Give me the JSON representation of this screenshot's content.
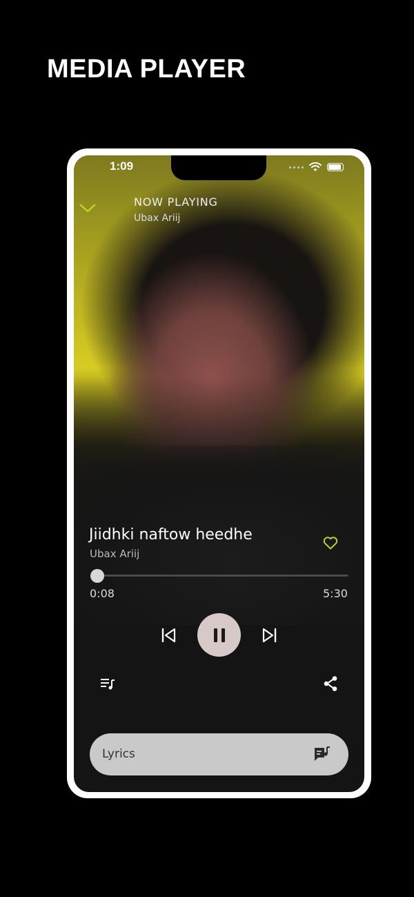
{
  "promo": {
    "title": "MEDIA PLAYER"
  },
  "status_bar": {
    "time": "1:09"
  },
  "header": {
    "now_playing_label": "NOW PLAYING",
    "artist": "Ubax Ariij"
  },
  "track": {
    "title": "Jiidhki naftow heedhe",
    "artist": "Ubax Ariij"
  },
  "progress": {
    "current": "0:08",
    "total": "5:30",
    "fraction": 0.024
  },
  "lyrics": {
    "label": "Lyrics"
  },
  "colors": {
    "accent": "#b5d62b",
    "play_button": "#d6c9c8",
    "lyrics_bar": "#c9c9c9"
  },
  "icons": [
    "chevron-down-icon",
    "heart-icon",
    "skip-previous-icon",
    "pause-icon",
    "skip-next-icon",
    "queue-icon",
    "share-icon",
    "lyrics-icon",
    "wifi-icon",
    "battery-icon"
  ]
}
